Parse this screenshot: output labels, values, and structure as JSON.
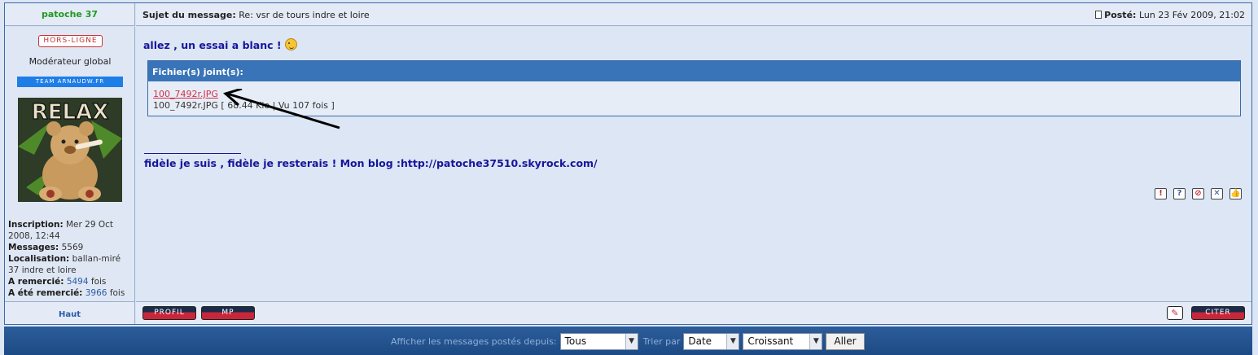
{
  "post": {
    "author": "patoche 37",
    "subject_label": "Sujet du message:",
    "subject": "Re: vsr de tours indre et loire",
    "posted_label": "Posté:",
    "posted": "Lun 23 Fév 2009, 21:02"
  },
  "profile": {
    "status": "HORS-LIGNE",
    "rank": "Modérateur global",
    "team_banner": "TEAM ARNAUDW.FR",
    "avatar_text": "RELAX",
    "stats": [
      {
        "label": "Inscription:",
        "value": "Mer 29 Oct 2008, 12:44"
      },
      {
        "label": "Messages:",
        "value": "5569"
      },
      {
        "label": "Localisation:",
        "value": "ballan-miré 37 indre et loire"
      },
      {
        "label": "A remercié:",
        "value": "5494",
        "suffix": "fois"
      },
      {
        "label": "A été remercié:",
        "value": "3966",
        "suffix": "fois"
      }
    ]
  },
  "message": {
    "text": "allez , un essai a blanc !",
    "smiley": "wink-smiley-icon"
  },
  "attachment": {
    "title": "Fichier(s) joint(s):",
    "link": "100_7492r.JPG",
    "filename": "100_7492r.JPG",
    "meta": "[ 68.44 Kio | Vu 107 fois ]"
  },
  "signature": "fidèle je suis , fidèle je resterais ! Mon blog :http://patoche37510.skyrock.com/",
  "mod_icons": [
    "!",
    "?",
    "⊘",
    "✕",
    "👍"
  ],
  "footer": {
    "top_link": "Haut",
    "profile_btn": "PROFIL",
    "pm_btn": "MP",
    "quote_btn": "CITER"
  },
  "bottom_bar": {
    "show_label": "Afficher les messages postés depuis:",
    "show_value": "Tous",
    "sort_label": "Trier par",
    "sort_value": "Date",
    "order_value": "Croissant",
    "go_label": "Aller"
  },
  "colors": {
    "author": "#1f9a1f",
    "message_text": "#16169c",
    "attachment_header": "#3a74b8",
    "link": "#d0304a"
  }
}
